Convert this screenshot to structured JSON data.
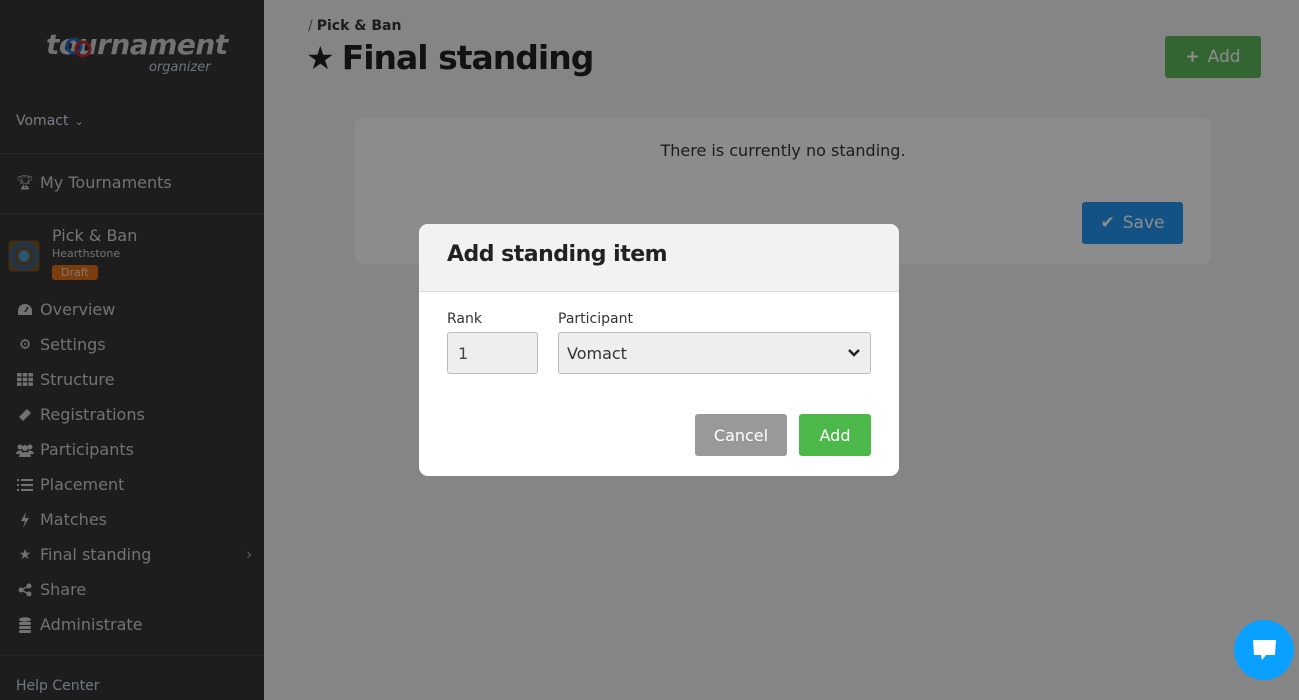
{
  "app": {
    "logo_text": "tournament",
    "logo_subtext": "organizer"
  },
  "sidebar": {
    "user": "Vomact",
    "my_tournaments": "My Tournaments",
    "tournament": {
      "name": "Pick & Ban",
      "game": "Hearthstone",
      "status": "Draft"
    },
    "items": [
      {
        "label": "Overview",
        "icon": "dashboard-icon"
      },
      {
        "label": "Settings",
        "icon": "gears-icon"
      },
      {
        "label": "Structure",
        "icon": "grid-icon"
      },
      {
        "label": "Registrations",
        "icon": "ticket-icon"
      },
      {
        "label": "Participants",
        "icon": "users-icon"
      },
      {
        "label": "Placement",
        "icon": "ordered-list-icon"
      },
      {
        "label": "Matches",
        "icon": "bolt-icon"
      },
      {
        "label": "Final standing",
        "icon": "star-icon",
        "active": true
      },
      {
        "label": "Share",
        "icon": "share-icon"
      },
      {
        "label": "Administrate",
        "icon": "database-icon"
      }
    ],
    "help_center": "Help Center"
  },
  "header": {
    "breadcrumb": "Pick & Ban",
    "title": "Final standing",
    "add_label": "Add"
  },
  "standing_card": {
    "empty_message": "There is currently no standing.",
    "save_label": "Save"
  },
  "modal": {
    "title": "Add standing item",
    "rank_label": "Rank",
    "rank_value": "1",
    "participant_label": "Participant",
    "participant_value": "Vomact",
    "cancel_label": "Cancel",
    "add_label": "Add"
  },
  "colors": {
    "sidebar_bg": "#353535",
    "success": "#5cb85c",
    "primary": "#2196f3",
    "draft_badge": "#e0701a",
    "chat": "#0aa0ff"
  }
}
